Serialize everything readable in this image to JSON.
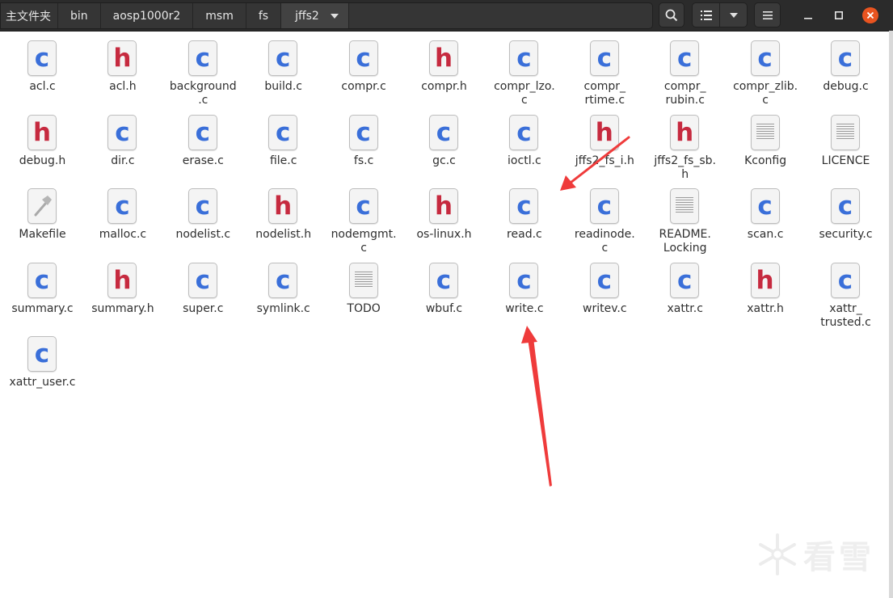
{
  "breadcrumb": [
    "主文件夹",
    "bin",
    "aosp1000r2",
    "msm",
    "fs",
    "jffs2"
  ],
  "toolbar": {
    "search_icon": "search-icon",
    "view_icon": "list-view-icon",
    "view_menu_icon": "chevron-down-icon",
    "menu_icon": "hamburger-menu-icon"
  },
  "window_controls": {
    "minimize": "minimize-icon",
    "maximize": "maximize-icon",
    "close": "close-icon",
    "close_color": "#e95420"
  },
  "colors": {
    "c_file": "#3a6fd9",
    "h_file": "#c62a3f",
    "annotation_arrow": "#ef3b3b"
  },
  "files": [
    {
      "name": "acl.c",
      "type": "c"
    },
    {
      "name": "acl.h",
      "type": "h"
    },
    {
      "name": "background\n.c",
      "type": "c"
    },
    {
      "name": "build.c",
      "type": "c"
    },
    {
      "name": "compr.c",
      "type": "c"
    },
    {
      "name": "compr.h",
      "type": "h"
    },
    {
      "name": "compr_lzo.\nc",
      "type": "c"
    },
    {
      "name": "compr_\nrtime.c",
      "type": "c"
    },
    {
      "name": "compr_\nrubin.c",
      "type": "c"
    },
    {
      "name": "compr_zlib.\nc",
      "type": "c"
    },
    {
      "name": "debug.c",
      "type": "c"
    },
    {
      "name": "debug.h",
      "type": "h"
    },
    {
      "name": "dir.c",
      "type": "c"
    },
    {
      "name": "erase.c",
      "type": "c"
    },
    {
      "name": "file.c",
      "type": "c"
    },
    {
      "name": "fs.c",
      "type": "c"
    },
    {
      "name": "gc.c",
      "type": "c"
    },
    {
      "name": "ioctl.c",
      "type": "c"
    },
    {
      "name": "jffs2_fs_i.h",
      "type": "h"
    },
    {
      "name": "jffs2_fs_sb.\nh",
      "type": "h"
    },
    {
      "name": "Kconfig",
      "type": "text"
    },
    {
      "name": "LICENCE",
      "type": "text"
    },
    {
      "name": "Makefile",
      "type": "make"
    },
    {
      "name": "malloc.c",
      "type": "c"
    },
    {
      "name": "nodelist.c",
      "type": "c"
    },
    {
      "name": "nodelist.h",
      "type": "h"
    },
    {
      "name": "nodemgmt.\nc",
      "type": "c"
    },
    {
      "name": "os-linux.h",
      "type": "h"
    },
    {
      "name": "read.c",
      "type": "c"
    },
    {
      "name": "readinode.\nc",
      "type": "c"
    },
    {
      "name": "README.\nLocking",
      "type": "text"
    },
    {
      "name": "scan.c",
      "type": "c"
    },
    {
      "name": "security.c",
      "type": "c"
    },
    {
      "name": "summary.c",
      "type": "c"
    },
    {
      "name": "summary.h",
      "type": "h"
    },
    {
      "name": "super.c",
      "type": "c"
    },
    {
      "name": "symlink.c",
      "type": "c"
    },
    {
      "name": "TODO",
      "type": "text"
    },
    {
      "name": "wbuf.c",
      "type": "c"
    },
    {
      "name": "write.c",
      "type": "c"
    },
    {
      "name": "writev.c",
      "type": "c"
    },
    {
      "name": "xattr.c",
      "type": "c"
    },
    {
      "name": "xattr.h",
      "type": "h"
    },
    {
      "name": "xattr_\ntrusted.c",
      "type": "c"
    },
    {
      "name": "xattr_user.c",
      "type": "c"
    }
  ],
  "annotations": [
    {
      "target_file": "read.c",
      "color": "#ef3b3b"
    },
    {
      "target_file": "write.c",
      "color": "#ef3b3b"
    }
  ],
  "watermark": {
    "text": "看雪",
    "icon": "snowflake-icon"
  }
}
